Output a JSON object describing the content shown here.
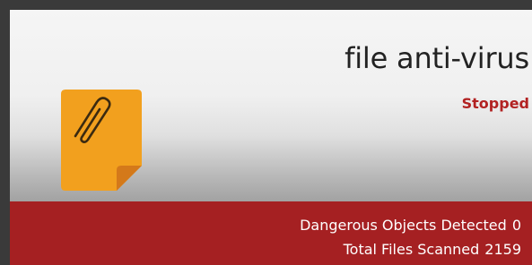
{
  "module": {
    "title": "file anti-virus",
    "status": "Stopped",
    "status_color": "#b22222",
    "icon": "paperclip-document-icon",
    "icon_color": "#f0a020"
  },
  "stats": {
    "background_color": "#a52022",
    "dangerous_objects_label": "Dangerous Objects Detected",
    "dangerous_objects_value": "0",
    "total_files_label": "Total Files Scanned",
    "total_files_value": "2159"
  }
}
